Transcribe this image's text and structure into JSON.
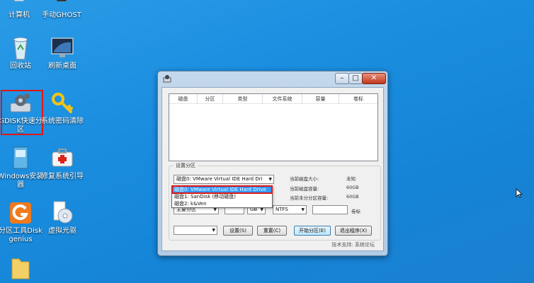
{
  "desktop": {
    "icons": [
      {
        "label": "计算机"
      },
      {
        "label": "手动GHOST"
      },
      {
        "label": "回收站"
      },
      {
        "label": "刷新桌面"
      },
      {
        "label": "GDISK快速分区"
      },
      {
        "label": "系统密码清除"
      },
      {
        "label": "Windows安装器"
      },
      {
        "label": "修复系统引导"
      },
      {
        "label": "分区工具Diskgenius"
      },
      {
        "label": "虚拟光驱"
      }
    ]
  },
  "window": {
    "controls": {
      "min": "–",
      "max": "□",
      "close": "✕"
    },
    "table_headers": [
      "磁盘",
      "分区",
      "类型",
      "文件系统",
      "容量",
      "卷标"
    ],
    "group_title": "设置分区",
    "disk_select": "磁盘0: VMware Virtual IDE Hard Dri",
    "dropdown_options": [
      "磁盘0: VMware Virtual IDE Hard Drive",
      "磁盘1: SanDisk (移动磁盘)",
      "磁盘2: k&Ven"
    ],
    "main_partition_label": "主要分区",
    "unit": "GB",
    "filesystem": "NTFS",
    "volume_label": "卷标",
    "info_labels": [
      "当前磁盘大小:",
      "当前磁盘容量:",
      "当前未分分区容量:"
    ],
    "info_values": [
      "未知",
      "60GB",
      "60GB"
    ],
    "buttons": {
      "settings": "设置(S)",
      "reset": "重置(C)",
      "start": "开始分区(E)",
      "exit": "退出程序(X)"
    },
    "footer": "技术支持: 系统论坛"
  },
  "colors": {
    "desktop": "#1b8ee0",
    "highlight": "#e01616",
    "selection": "#3399ff"
  }
}
